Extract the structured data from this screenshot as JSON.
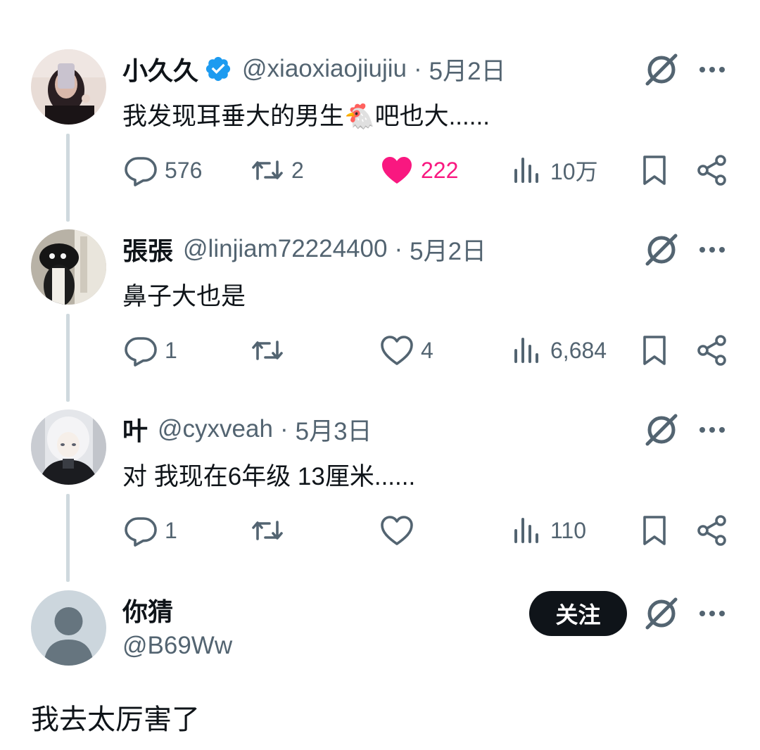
{
  "colors": {
    "text": "#0f1419",
    "muted": "#536471",
    "like": "#f91880",
    "verified": "#1d9bf0",
    "thread_line": "#cfd9de"
  },
  "replies": [
    {
      "name": "小久久",
      "verified": true,
      "handle": "@xiaoxiaojiujiu",
      "sep": "·",
      "date": "5月2日",
      "text": "我发现耳垂大的男生🐔吧也大......",
      "reply_count": "576",
      "retweet_count": "2",
      "like_count": "222",
      "liked": true,
      "views": "10万"
    },
    {
      "name": "張張",
      "verified": false,
      "handle": "@linjiam72224400",
      "sep": "·",
      "date": "5月2日",
      "text": "鼻子大也是",
      "reply_count": "1",
      "retweet_count": "",
      "like_count": "4",
      "liked": false,
      "views": "6,684"
    },
    {
      "name": "叶",
      "verified": false,
      "handle": "@cyxveah",
      "sep": "·",
      "date": "5月3日",
      "text": "对 我现在6年级 13厘米......",
      "reply_count": "1",
      "retweet_count": "",
      "like_count": "",
      "liked": false,
      "views": "110"
    }
  ],
  "main_post": {
    "name": "你猜",
    "handle": "@B69Ww",
    "follow_label": "关注",
    "text": "我去太厉害了"
  },
  "icons": {
    "reply": "speech-bubble-icon",
    "retweet": "retweet-arrows-icon",
    "like": "heart-icon",
    "views": "bar-chart-icon",
    "bookmark": "bookmark-icon",
    "share": "share-icon",
    "grok": "grok-slash-circle-icon",
    "more": "more-dots-icon"
  }
}
